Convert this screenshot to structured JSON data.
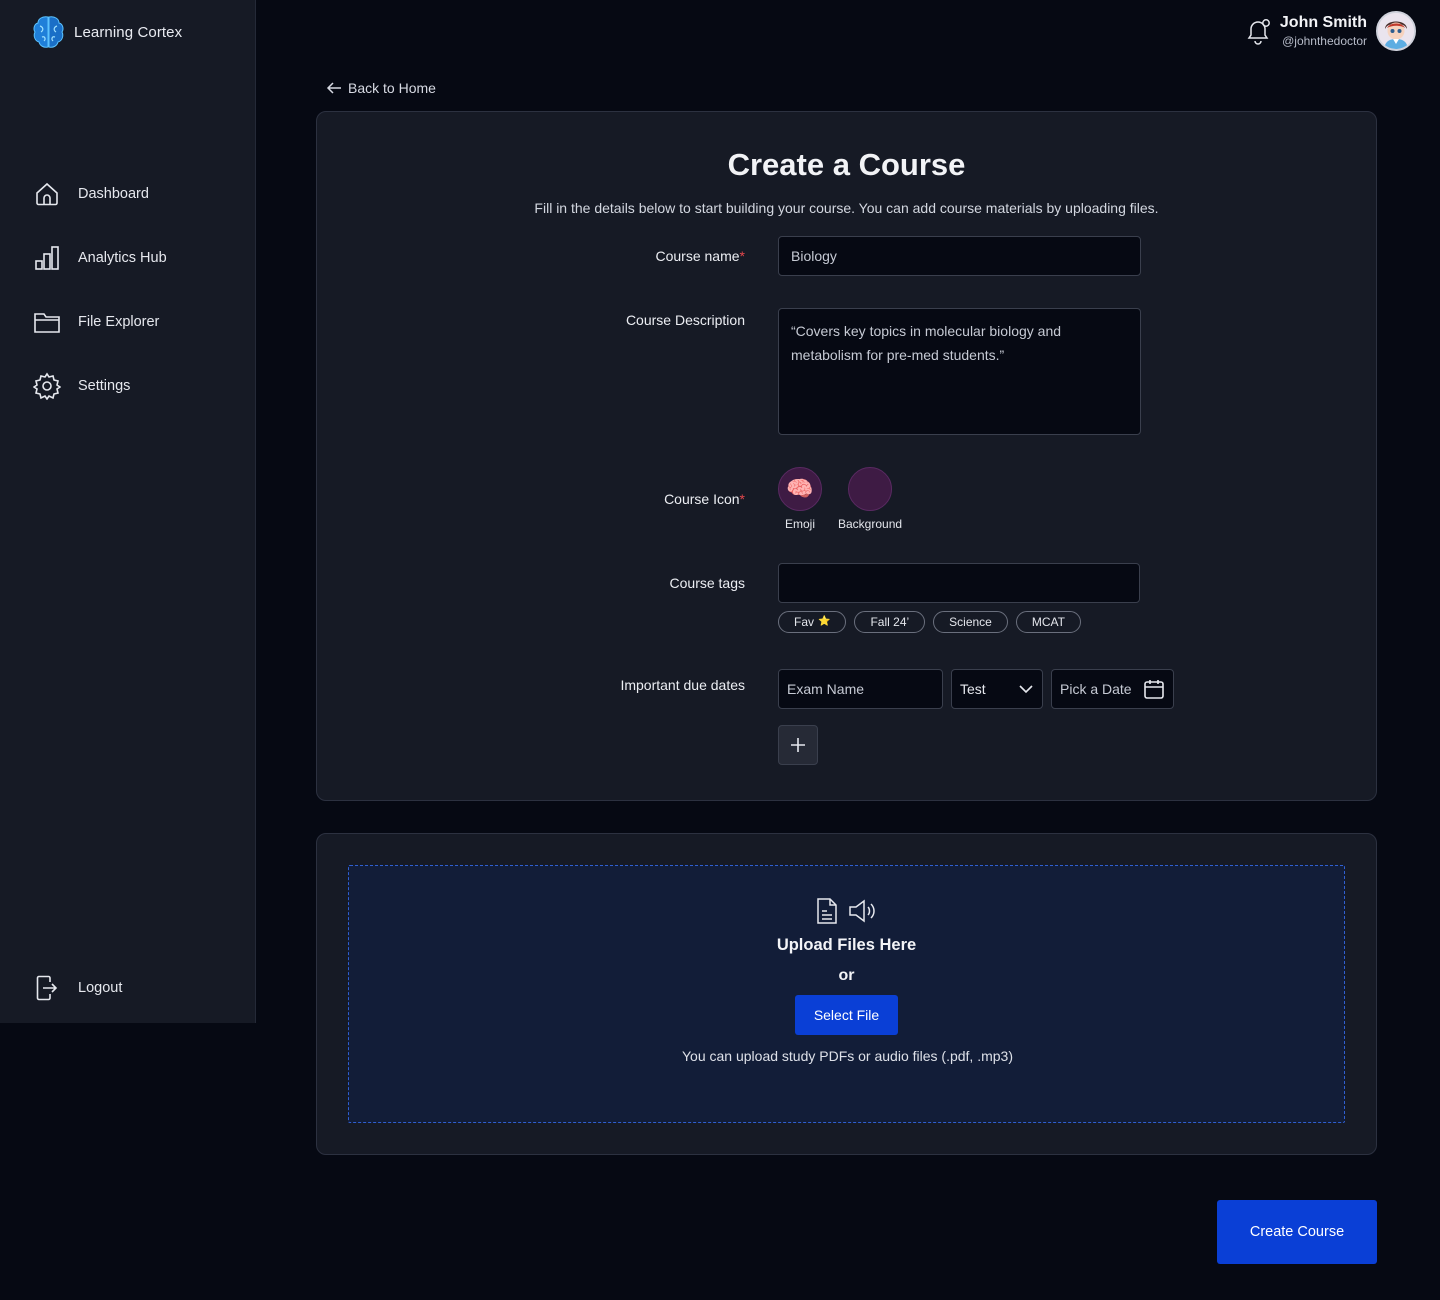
{
  "app": {
    "name": "Learning Cortex"
  },
  "sidebar": {
    "items": [
      {
        "label": "Dashboard",
        "icon": "home-icon"
      },
      {
        "label": "Analytics Hub",
        "icon": "bar-chart-icon"
      },
      {
        "label": "File Explorer",
        "icon": "folder-icon"
      },
      {
        "label": "Settings",
        "icon": "gear-icon"
      }
    ],
    "logout_label": "Logout"
  },
  "user": {
    "name": "John Smith",
    "handle": "@johnthedoctor"
  },
  "nav": {
    "back_label": "Back to Home"
  },
  "form": {
    "title": "Create a Course",
    "subtitle": "Fill in the details below to start building your course. You can add course materials by uploading files.",
    "course_name": {
      "label": "Course name",
      "required_mark": "*",
      "value": "Biology"
    },
    "course_description": {
      "label": "Course Description",
      "value": "“Covers key topics in molecular biology and metabolism for pre-med students.”"
    },
    "course_icon": {
      "label": "Course Icon",
      "required_mark": "*",
      "emoji_label": "Emoji",
      "emoji": "🧠",
      "background_label": "Background",
      "background_color": "#3e1b44"
    },
    "course_tags": {
      "label": "Course tags",
      "value": "",
      "tags": [
        "Fav",
        "Fall 24’",
        "Science",
        "MCAT"
      ],
      "fav_star": "⭐"
    },
    "due_dates": {
      "label": "Important due dates",
      "exam_placeholder": "Exam Name",
      "type_value": "Test",
      "date_placeholder": "Pick a Date"
    }
  },
  "upload": {
    "title": "Upload Files Here",
    "or_label": "or",
    "select_label": "Select File",
    "hint": "You can upload study PDFs or audio files (.pdf, .mp3)"
  },
  "actions": {
    "create_label": "Create Course"
  },
  "colors": {
    "accent": "#0a3fd6",
    "required": "#e5484d",
    "drop_border": "#2f5fd1"
  }
}
